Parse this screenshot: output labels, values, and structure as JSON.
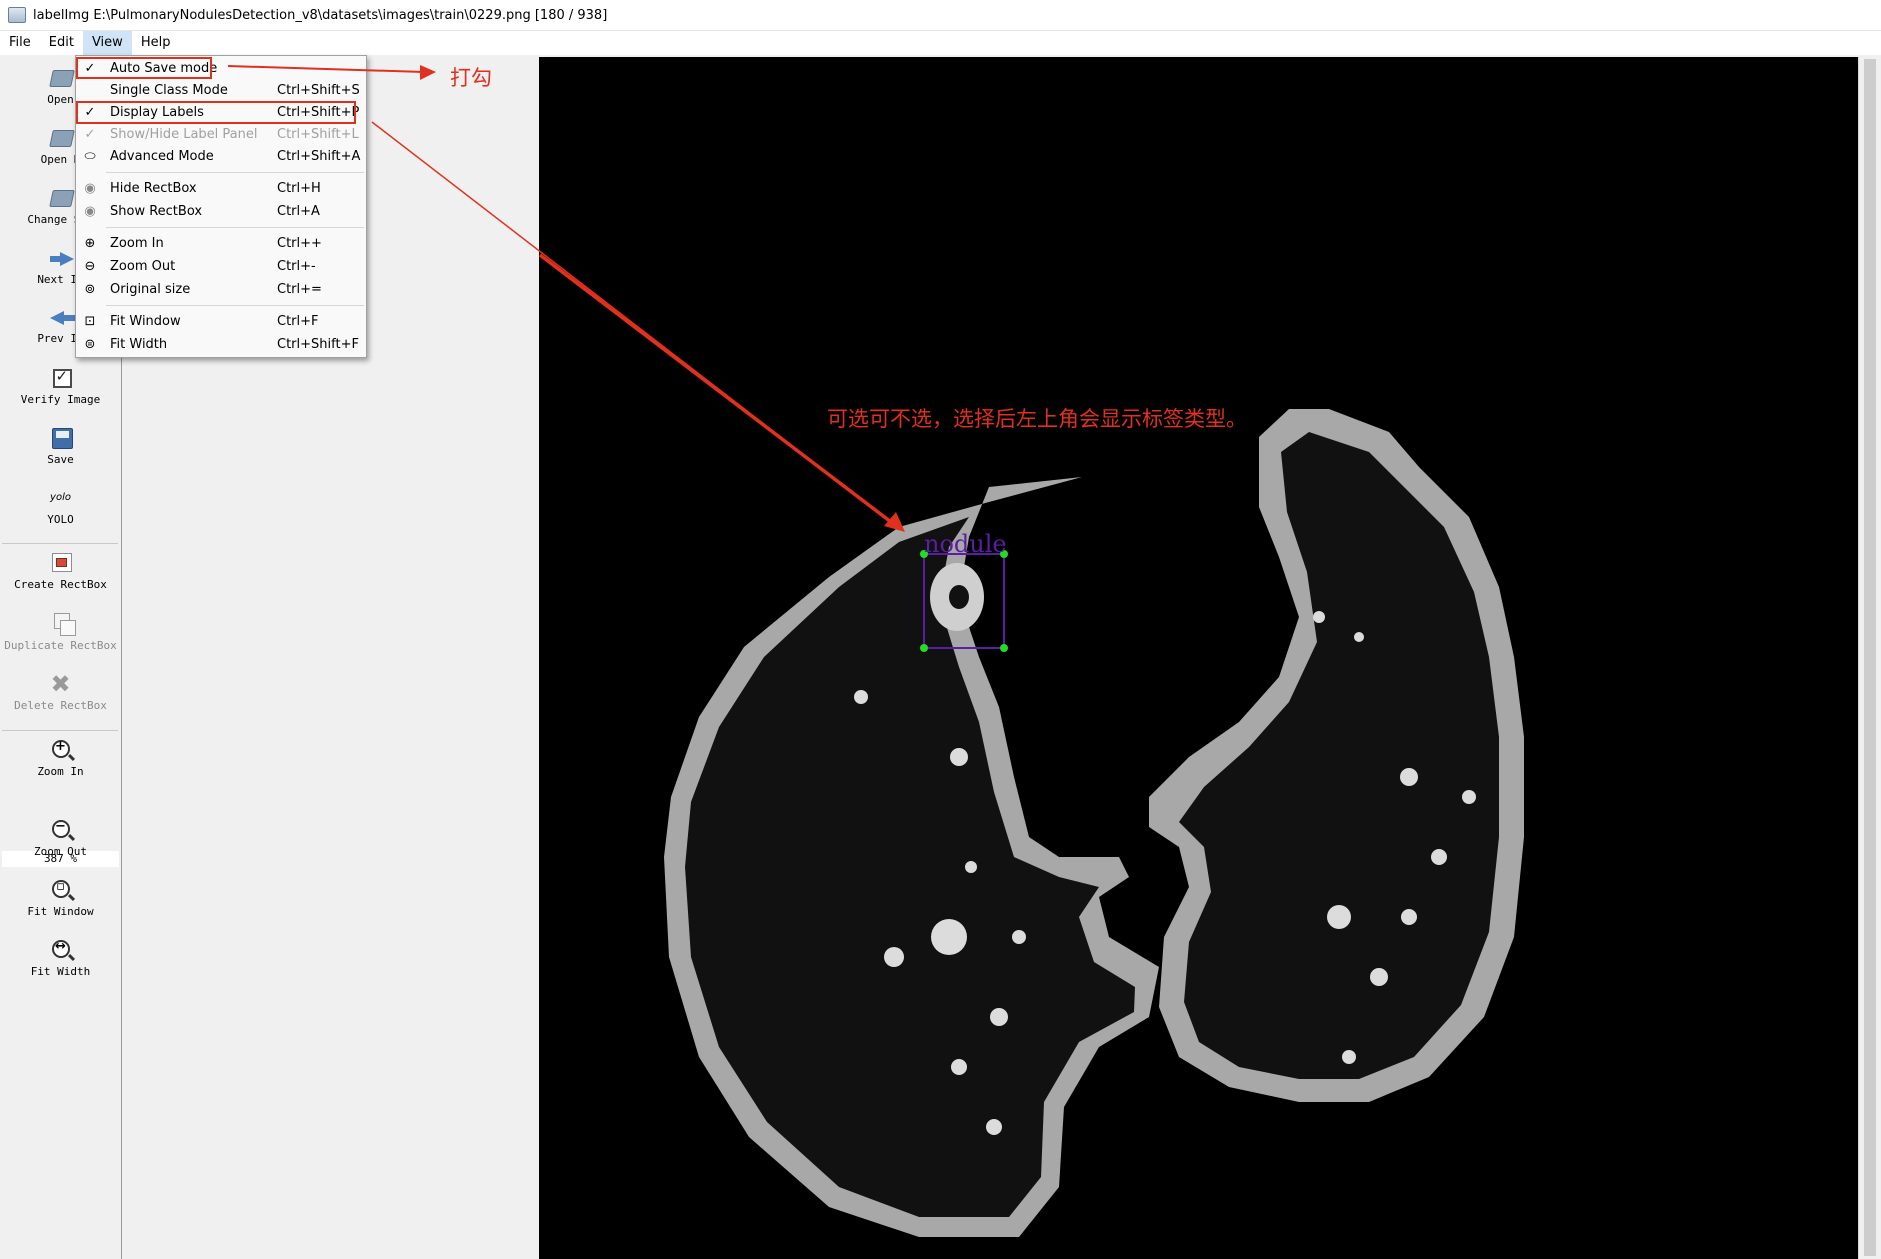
{
  "window": {
    "title": "labelImg E:\\PulmonaryNodulesDetection_v8\\datasets\\images\\train\\0229.png [180 / 938]"
  },
  "menubar": {
    "items": [
      {
        "label": "File"
      },
      {
        "label": "Edit"
      },
      {
        "label": "View",
        "active": true
      },
      {
        "label": "Help"
      }
    ]
  },
  "toolbar": {
    "open": "Open",
    "open_dir": "Open D",
    "change_save_dir": "Change Sav",
    "next_image": "Next Im",
    "prev_image": "Prev Im",
    "verify_image": "Verify Image",
    "save": "Save",
    "format_icon_text": "yolo",
    "format": "YOLO",
    "create_rectbox": "Create RectBox",
    "duplicate_rectbox": "Duplicate RectBox",
    "delete_rectbox": "Delete RectBox",
    "zoom_in": "Zoom In",
    "zoom_value": "387 %",
    "zoom_out": "Zoom Out",
    "fit_window": "Fit Window",
    "fit_width": "Fit Width"
  },
  "view_menu": {
    "items": [
      {
        "label": "Auto Save mode",
        "shortcut": "",
        "checked": true,
        "enabled": true,
        "icon": "check-icon"
      },
      {
        "label": "Single Class Mode",
        "shortcut": "Ctrl+Shift+S",
        "checked": false,
        "enabled": true,
        "icon": ""
      },
      {
        "label": "Display Labels",
        "shortcut": "Ctrl+Shift+P",
        "checked": true,
        "enabled": true,
        "icon": "check-icon"
      },
      {
        "label": "Show/Hide Label Panel",
        "shortcut": "Ctrl+Shift+L",
        "checked": true,
        "enabled": false,
        "icon": "check-icon"
      },
      {
        "label": "Advanced Mode",
        "shortcut": "Ctrl+Shift+A",
        "checked": false,
        "enabled": true,
        "icon": "tag-icon"
      },
      {
        "label": "Hide RectBox",
        "shortcut": "Ctrl+H",
        "checked": false,
        "enabled": true,
        "icon": "eye-icon"
      },
      {
        "label": "Show RectBox",
        "shortcut": "Ctrl+A",
        "checked": false,
        "enabled": true,
        "icon": "eye-icon"
      },
      {
        "label": "Zoom In",
        "shortcut": "Ctrl++",
        "checked": false,
        "enabled": true,
        "icon": "zoom-in-icon"
      },
      {
        "label": "Zoom Out",
        "shortcut": "Ctrl+-",
        "checked": false,
        "enabled": true,
        "icon": "zoom-out-icon"
      },
      {
        "label": "Original size",
        "shortcut": "Ctrl+=",
        "checked": false,
        "enabled": true,
        "icon": "zoom-original-icon"
      },
      {
        "label": "Fit Window",
        "shortcut": "Ctrl+F",
        "checked": false,
        "enabled": true,
        "icon": "fit-window-icon"
      },
      {
        "label": "Fit Width",
        "shortcut": "Ctrl+Shift+F",
        "checked": false,
        "enabled": true,
        "icon": "fit-width-icon"
      }
    ]
  },
  "canvas": {
    "box_label": "nodule",
    "box_color": "#5a1fa0",
    "handle_color": "#22dd22"
  },
  "annotations": {
    "check_note": "打勾",
    "label_note": "可选可不选，选择后左上角会显示标签类型。",
    "color": "#e0301e"
  }
}
